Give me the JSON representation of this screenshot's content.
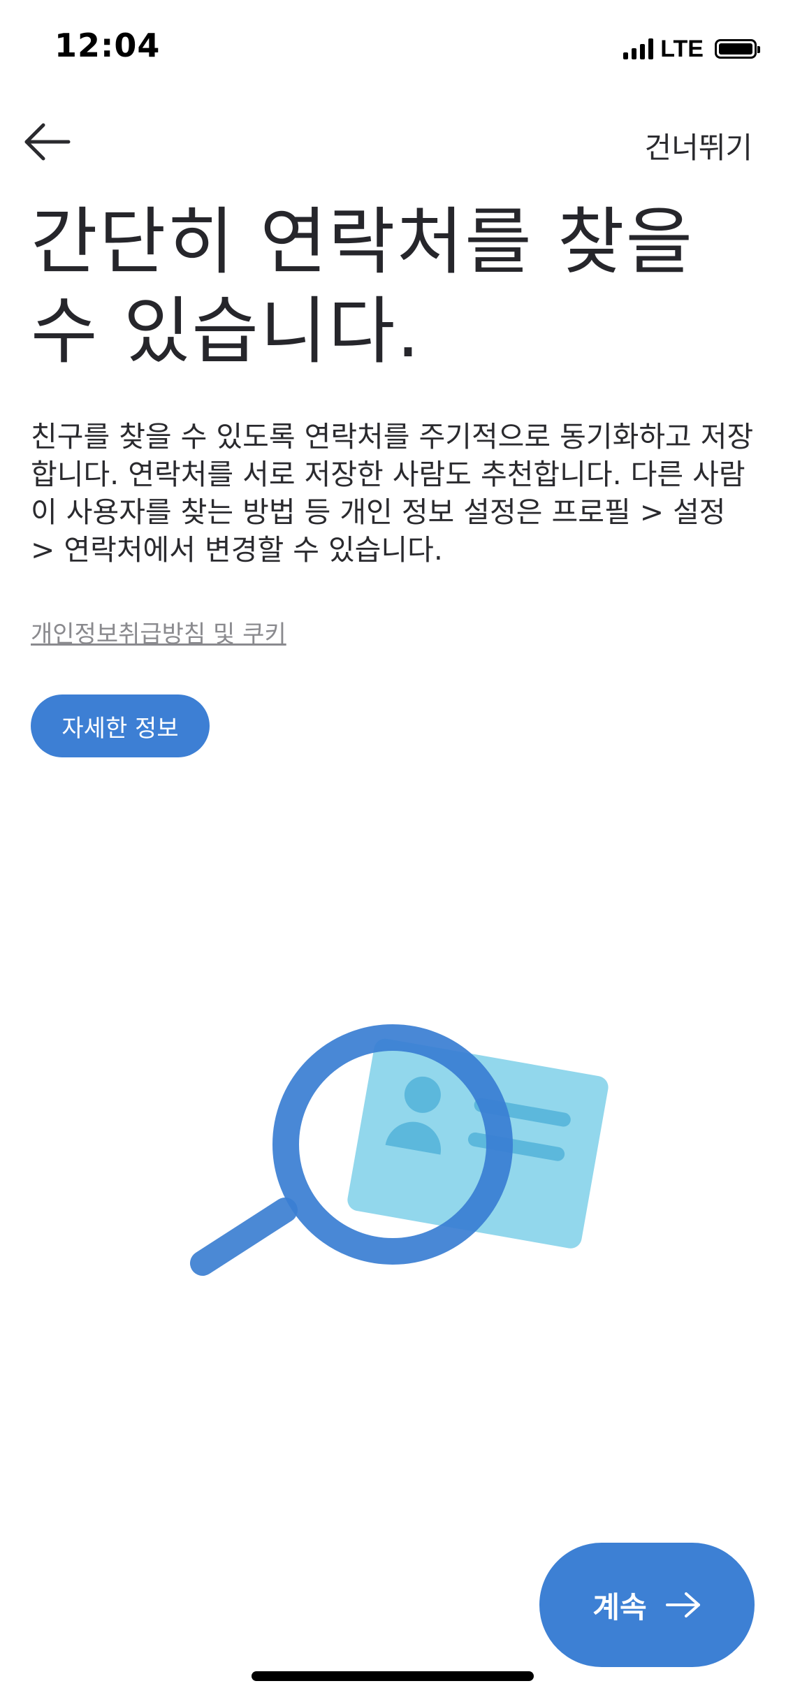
{
  "status_bar": {
    "time": "12:04",
    "network": "LTE",
    "icons": [
      "signal-icon",
      "battery-icon"
    ]
  },
  "nav": {
    "back_icon": "arrow-left-icon",
    "skip_label": "건너뛰기"
  },
  "main": {
    "title": "간단히 연락처를 찾을 수 있습니다.",
    "description": "친구를 찾을 수 있도록 연락처를 주기적으로 동기화하고 저장합니다. 연락처를 서로 저장한 사람도 추천합니다. 다른 사람이 사용자를 찾는 방법 등 개인 정보 설정은 프로필 > 설정 > 연락처에서 변경할 수 있습니다.",
    "privacy_link": "개인정보취급방침 및 쿠키",
    "more_info_label": "자세한 정보",
    "illustration": "contact-search-illustration"
  },
  "footer": {
    "continue_label": "계속",
    "continue_icon": "arrow-right-icon"
  },
  "colors": {
    "accent": "#3d80d4",
    "card": "#7fd0ea",
    "text": "#2a2a2e",
    "muted": "#8a8a8e"
  }
}
